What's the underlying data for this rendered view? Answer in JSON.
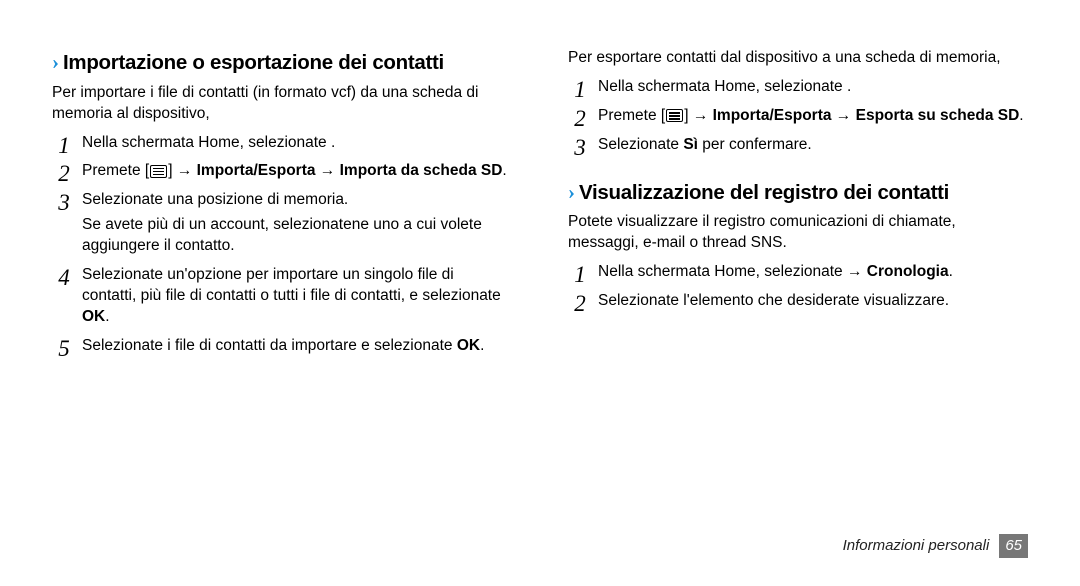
{
  "left": {
    "heading1": "Importazione o esportazione dei contatti",
    "para1": "Per importare i file di contatti (in formato vcf) da una scheda di memoria al dispositivo,",
    "steps1": {
      "s1": "Nella schermata Home, selezionate       .",
      "s2a": "Premete [",
      "s2b": "] → ",
      "s2c": "Importa/Esporta",
      "s2d": " → ",
      "s2e": "Importa da scheda SD",
      "s2f": ".",
      "s3": "Selezionate una posizione di memoria.",
      "s3sub": "Se avete più di un account, selezionatene uno a cui volete aggiungere il contatto.",
      "s4a": "Selezionate un'opzione per importare un singolo file di contatti, più file di contatti o tutti i file di contatti, e selezionate ",
      "s4b": "OK",
      "s4c": ".",
      "s5a": "Selezionate i file di contatti da importare e selezionate ",
      "s5b": "OK",
      "s5c": "."
    }
  },
  "right": {
    "para_top": "Per esportare contatti dal dispositivo a una scheda di memoria,",
    "stepsA": {
      "s1": "Nella schermata Home, selezionate       .",
      "s2a": "Premete [",
      "s2b": "] → ",
      "s2c": "Importa/Esporta",
      "s2d": " → ",
      "s2e": "Esporta su scheda SD",
      "s2f": ".",
      "s3a": "Selezionate ",
      "s3b": "Sì",
      "s3c": " per confermare."
    },
    "heading2": "Visualizzazione del registro dei contatti",
    "para2": "Potete visualizzare il registro comunicazioni di chiamate, messaggi, e-mail o thread SNS.",
    "stepsB": {
      "s1a": "Nella schermata Home, selezionate        → ",
      "s1b": "Cronologia",
      "s1c": ".",
      "s2": "Selezionate l'elemento che desiderate visualizzare."
    }
  },
  "footer": {
    "label": "Informazioni personali",
    "page": "65"
  }
}
